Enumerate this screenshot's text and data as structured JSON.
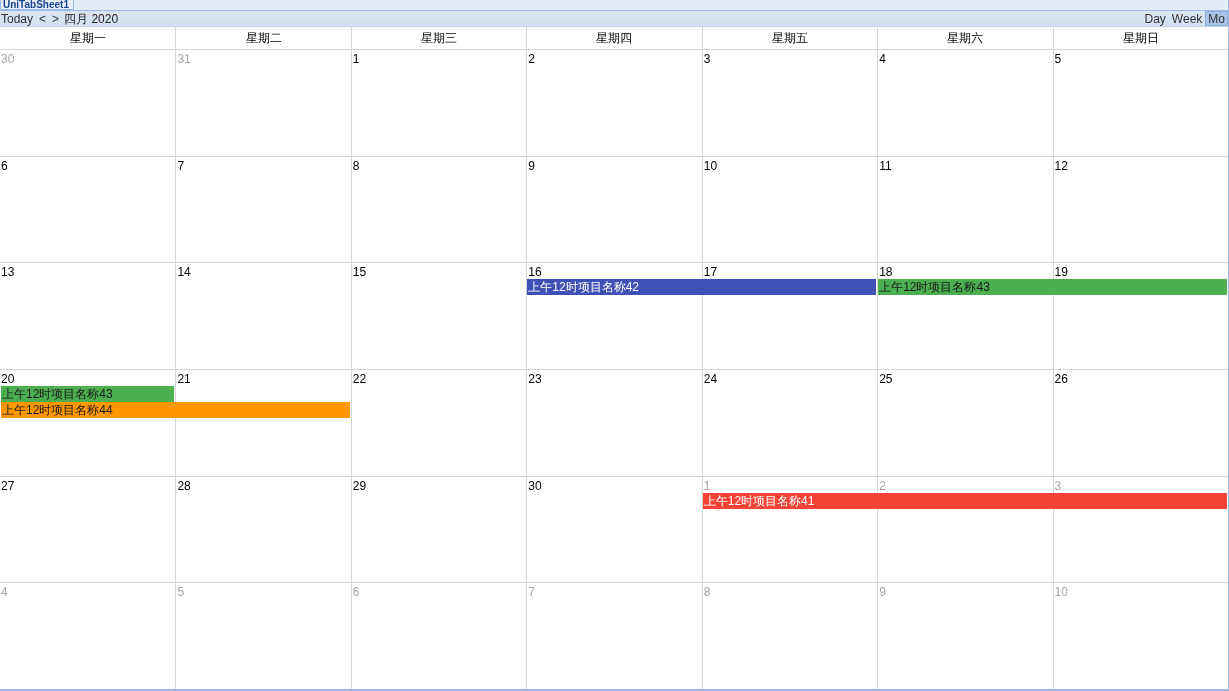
{
  "tabs": [
    {
      "label": "UniTabSheet1",
      "selected": true
    }
  ],
  "toolbar": {
    "today": "Today",
    "prev": "<",
    "next": ">",
    "month_label": "四月 2020",
    "views": [
      {
        "label": "Day",
        "selected": false
      },
      {
        "label": "Week",
        "selected": false
      },
      {
        "label": "Mo",
        "selected": true
      }
    ]
  },
  "weekdays": [
    "星期一",
    "星期二",
    "星期三",
    "星期四",
    "星期五",
    "星期六",
    "星期日"
  ],
  "weeks": [
    {
      "days": [
        {
          "label": "30",
          "other_month": true
        },
        {
          "label": "31",
          "other_month": true
        },
        {
          "label": "1",
          "other_month": false
        },
        {
          "label": "2",
          "other_month": false
        },
        {
          "label": "3",
          "other_month": false
        },
        {
          "label": "4",
          "other_month": false
        },
        {
          "label": "5",
          "other_month": false
        }
      ]
    },
    {
      "days": [
        {
          "label": "6",
          "other_month": false
        },
        {
          "label": "7",
          "other_month": false
        },
        {
          "label": "8",
          "other_month": false
        },
        {
          "label": "9",
          "other_month": false
        },
        {
          "label": "10",
          "other_month": false
        },
        {
          "label": "11",
          "other_month": false
        },
        {
          "label": "12",
          "other_month": false
        }
      ]
    },
    {
      "days": [
        {
          "label": "13",
          "other_month": false
        },
        {
          "label": "14",
          "other_month": false
        },
        {
          "label": "15",
          "other_month": false
        },
        {
          "label": "16",
          "other_month": false
        },
        {
          "label": "17",
          "other_month": false
        },
        {
          "label": "18",
          "other_month": false
        },
        {
          "label": "19",
          "other_month": false
        }
      ],
      "lanes": [
        [
          {
            "kind": "gap"
          },
          {
            "kind": "gap"
          },
          {
            "kind": "gap"
          },
          {
            "kind": "event",
            "title": "上午12时项目名称42",
            "color": "#3f51b5"
          },
          {
            "kind": "more"
          },
          {
            "kind": "event",
            "title": "上午12时项目名称43",
            "color": "#4caf50"
          },
          {
            "kind": "more"
          }
        ]
      ]
    },
    {
      "days": [
        {
          "label": "20",
          "other_month": false
        },
        {
          "label": "21",
          "other_month": false
        },
        {
          "label": "22",
          "other_month": false
        },
        {
          "label": "23",
          "other_month": false
        },
        {
          "label": "24",
          "other_month": false
        },
        {
          "label": "25",
          "other_month": false
        },
        {
          "label": "26",
          "other_month": false
        }
      ],
      "lanes": [
        [
          {
            "kind": "event",
            "title": "上午12时项目名称43",
            "color": "#4caf50"
          }
        ],
        [
          {
            "kind": "event",
            "title": "上午12时项目名称44",
            "color": "#ff9800"
          },
          {
            "kind": "more"
          }
        ]
      ]
    },
    {
      "days": [
        {
          "label": "27",
          "other_month": false
        },
        {
          "label": "28",
          "other_month": false
        },
        {
          "label": "29",
          "other_month": false
        },
        {
          "label": "30",
          "other_month": false
        },
        {
          "label": "1",
          "other_month": true
        },
        {
          "label": "2",
          "other_month": true
        },
        {
          "label": "3",
          "other_month": true
        }
      ],
      "lanes": [
        [
          {
            "kind": "gap"
          },
          {
            "kind": "gap"
          },
          {
            "kind": "gap"
          },
          {
            "kind": "gap"
          },
          {
            "kind": "event",
            "title": "上午12时项目名称41",
            "color": "#f44336"
          },
          {
            "kind": "more"
          },
          {
            "kind": "more"
          }
        ]
      ]
    },
    {
      "days": [
        {
          "label": "4",
          "other_month": true
        },
        {
          "label": "5",
          "other_month": true
        },
        {
          "label": "6",
          "other_month": true
        },
        {
          "label": "7",
          "other_month": true
        },
        {
          "label": "8",
          "other_month": true
        },
        {
          "label": "9",
          "other_month": true
        },
        {
          "label": "10",
          "other_month": true
        }
      ]
    }
  ]
}
